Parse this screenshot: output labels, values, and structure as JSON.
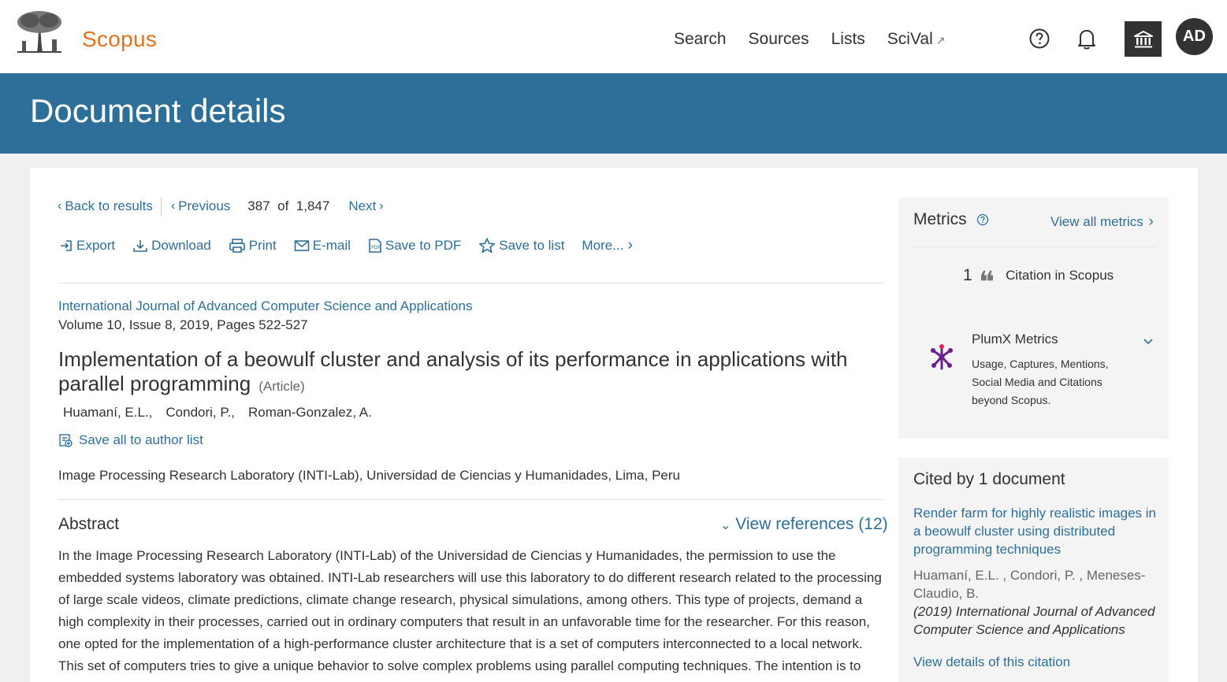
{
  "header": {
    "brand": "Scopus",
    "nav": [
      "Search",
      "Sources",
      "Lists",
      "SciVal"
    ],
    "scival_arrow": "↗",
    "avatar_initials": "AD"
  },
  "banner": {
    "title": "Document details"
  },
  "nav_row": {
    "back": "Back to results",
    "previous": "Previous",
    "current": "387",
    "of": "of",
    "total": "1,847",
    "next": "Next"
  },
  "actions": {
    "export": "Export",
    "download": "Download",
    "print": "Print",
    "email": "E-mail",
    "save_pdf": "Save to PDF",
    "save_list": "Save to list",
    "more": "More..."
  },
  "document": {
    "journal": "International Journal of Advanced Computer Science and Applications",
    "volume": "Volume 10, Issue 8, 2019, Pages 522-527",
    "title": "Implementation of a beowulf cluster and analysis of its performance in applications with parallel programming",
    "doctype": "(Article)",
    "authors": [
      "Huamaní, E.L.,",
      "Condori, P.,",
      "Roman-Gonzalez, A."
    ],
    "save_authors": "Save all to author list",
    "affiliation": "Image Processing Research Laboratory (INTI-Lab), Universidad de Ciencias y Humanidades, Lima, Peru",
    "abstract_heading": "Abstract",
    "view_references": "View references (12)",
    "abstract": "In the Image Processing Research Laboratory (INTI-Lab) of the Universidad de Ciencias y Humanidades, the permission to use the embedded systems laboratory was obtained. INTI-Lab researchers will use this laboratory to do different research related to the processing of large scale videos, climate predictions, climate change research, physical simulations, among others. This type of projects, demand a high complexity in their processes, carried out in ordinary computers that result in an unfavorable time for the researcher. For this reason, one opted for the implementation of a high-performance cluster architecture that is a set of computers interconnected to a local network. This set of computers tries to give a unique behavior to solve complex problems using parallel computing techniques. The intention is to"
  },
  "metrics": {
    "title": "Metrics",
    "view_all": "View all metrics",
    "citation_count": "1",
    "citation_label": "Citation in Scopus",
    "plumx_title": "PlumX Metrics",
    "plumx_desc": "Usage, Captures, Mentions, Social Media and Citations beyond Scopus."
  },
  "cited_by": {
    "title": "Cited by 1 document",
    "doc_title": "Render farm for highly realistic images in a beowulf cluster using distributed programming techniques",
    "doc_authors": "Huamaní, E.L. , Condori, P. , Meneses-Claudio, B.",
    "doc_source": "(2019) International Journal of Advanced Computer Science and Applications",
    "view_details": "View details of this citation"
  },
  "colors": {
    "brand_orange": "#e9711c",
    "banner_blue": "#2e6f9a",
    "link_blue": "#2e6f9a",
    "plumx_purple": "#6b1e8c"
  }
}
